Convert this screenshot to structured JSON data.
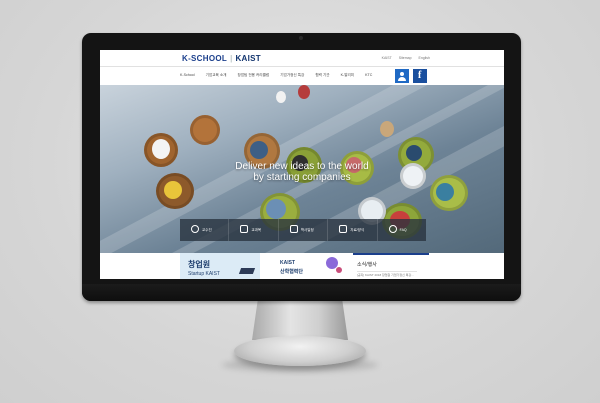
{
  "site": {
    "logo_left": "K-SCHOOL",
    "logo_sep": "|",
    "logo_right": "KAIST"
  },
  "top_links": [
    "KAIST",
    "Sitemap",
    "English"
  ],
  "nav": {
    "items": [
      "K-School",
      "기업교육 소개",
      "창업팀 전용 커리큘럼",
      "기업가정신 특강",
      "협력 기관",
      "K-알리미",
      "KTC"
    ]
  },
  "hero": {
    "line1": "Deliver new ideas to the world",
    "line2": "by starting companies"
  },
  "quick_menu": [
    {
      "label": "교수진",
      "icon": "person-icon"
    },
    {
      "label": "교과목",
      "icon": "book-icon"
    },
    {
      "label": "학사일정",
      "icon": "calendar-icon"
    },
    {
      "label": "자료/양식",
      "icon": "document-icon"
    },
    {
      "label": "FAQ",
      "icon": "chat-icon"
    }
  ],
  "cards": {
    "startup": {
      "title": "창업원",
      "subtitle": "Startup KAIST"
    },
    "industry": {
      "title_line1": "KAIST",
      "title_line2": "산학협력단"
    },
    "news": {
      "title": "소식/행사",
      "item": "[공지] KAIST 2018 창업원 기업가정신 특강..."
    }
  },
  "colors": {
    "brand_blue": "#1b3f8c",
    "facebook": "#1a4f9e",
    "user_button": "#1f69c4"
  }
}
